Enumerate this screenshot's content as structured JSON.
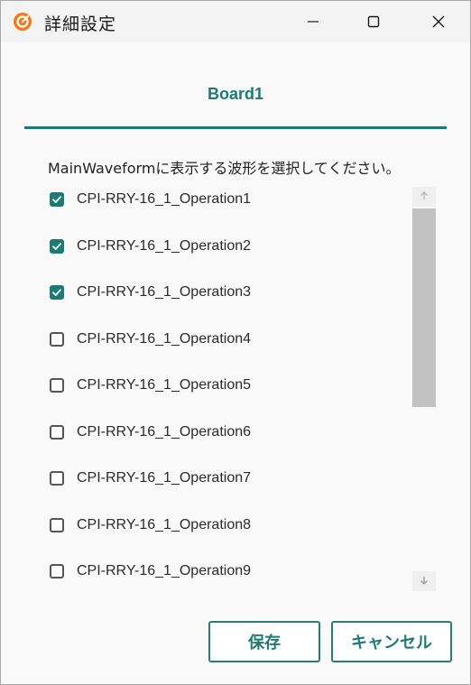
{
  "window": {
    "title": "詳細設定",
    "icon": "app-logo-icon",
    "controls": [
      "minimize-icon",
      "maximize-icon",
      "close-icon"
    ]
  },
  "tab": {
    "label": "Board1"
  },
  "instruction": "MainWaveformに表示する波形を選択してください。",
  "waveforms": [
    {
      "label": "CPI-RRY-16_1_Operation1",
      "checked": true
    },
    {
      "label": "CPI-RRY-16_1_Operation2",
      "checked": true
    },
    {
      "label": "CPI-RRY-16_1_Operation3",
      "checked": true
    },
    {
      "label": "CPI-RRY-16_1_Operation4",
      "checked": false
    },
    {
      "label": "CPI-RRY-16_1_Operation5",
      "checked": false
    },
    {
      "label": "CPI-RRY-16_1_Operation6",
      "checked": false
    },
    {
      "label": "CPI-RRY-16_1_Operation7",
      "checked": false
    },
    {
      "label": "CPI-RRY-16_1_Operation8",
      "checked": false
    },
    {
      "label": "CPI-RRY-16_1_Operation9",
      "checked": false
    }
  ],
  "buttons": {
    "save": "保存",
    "cancel": "キャンセル"
  },
  "colors": {
    "accent": "#1e7a73",
    "app_icon": "#f07b1a"
  }
}
